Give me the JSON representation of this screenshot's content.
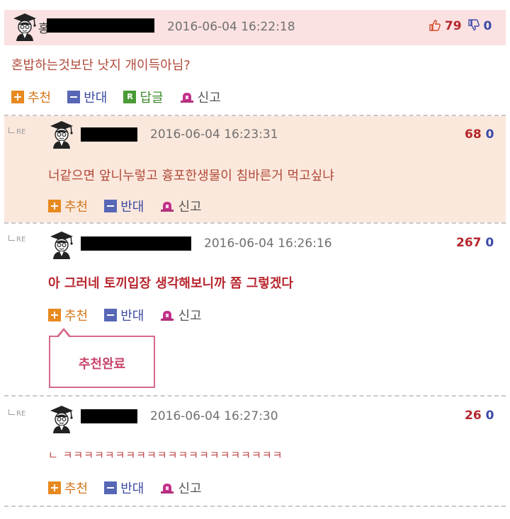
{
  "actions": {
    "recommend": "추천",
    "oppose": "반대",
    "reply": "답글",
    "report": "신고",
    "reply_icon_letter": "R"
  },
  "re_label": "RE",
  "tooltip_text": "추천완료",
  "comments": [
    {
      "nick_visible": "홍",
      "date": "2016-06-04 16:22:18",
      "up": "79",
      "down": "0",
      "text": "혼밥하는것보단 낫지 개이득아님?"
    },
    {
      "date": "2016-06-04 16:23:31",
      "up": "68",
      "down": "0",
      "text": "너같으면 앞니누렇고 흉포한생물이 침바른거 먹고싶냐"
    },
    {
      "date": "2016-06-04 16:26:16",
      "up": "267",
      "down": "0",
      "text": "아 그러네 토끼입장 생각해보니까 쫌 그렇겠다"
    },
    {
      "date": "2016-06-04 16:27:30",
      "up": "26",
      "down": "0",
      "text": "ㄴ ㅋㅋㅋㅋㅋㅋㅋㅋㅋㅋㅋㅋㅋㅋㅋㅋㅋㅋㅋㅋㅋ"
    }
  ],
  "colors": {
    "highlight_pink": "#fbe1e1",
    "highlight_peach": "#fbe8dc",
    "up_red": "#b5262c",
    "down_blue": "#3a4aa8",
    "recommend_orange": "#e7891f",
    "tooltip_pink": "#d46a88"
  },
  "icons": [
    "avatar-icon",
    "thumbs-up-icon",
    "thumbs-down-icon",
    "reply-arrow-icon",
    "plus-icon",
    "minus-icon",
    "reply-r-icon",
    "siren-icon"
  ]
}
